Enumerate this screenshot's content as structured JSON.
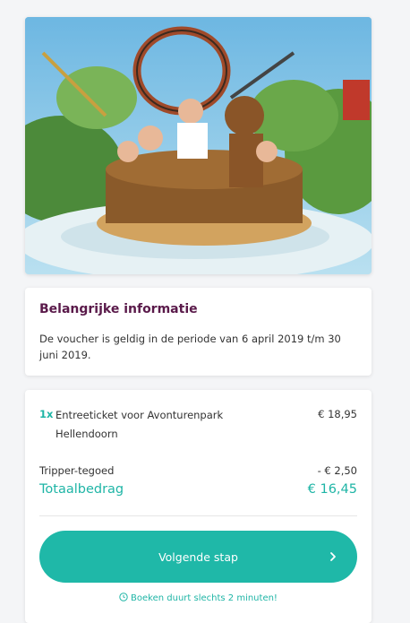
{
  "hero": {
    "image": "rapids-ride-photo"
  },
  "info": {
    "title": "Belangrijke informatie",
    "text": "De voucher is geldig in de periode van 6 april 2019 t/m 30 juni 2019."
  },
  "order": {
    "item": {
      "quantity": "1x",
      "name": "Entreeticket voor Avonturenpark Hellendoorn",
      "price": "€ 18,95"
    },
    "credit": {
      "label": "Tripper-tegoed",
      "amount": "- € 2,50"
    },
    "total": {
      "label": "Totaalbedrag",
      "amount": "€ 16,45"
    },
    "next_button": {
      "label": "Volgende stap",
      "icon": "chevron-right-icon"
    },
    "note": {
      "icon": "clock-icon",
      "text": "Boeken duurt slechts 2 minuten!"
    }
  },
  "colors": {
    "accent": "#1fb8a8",
    "title": "#5a1a4a"
  }
}
